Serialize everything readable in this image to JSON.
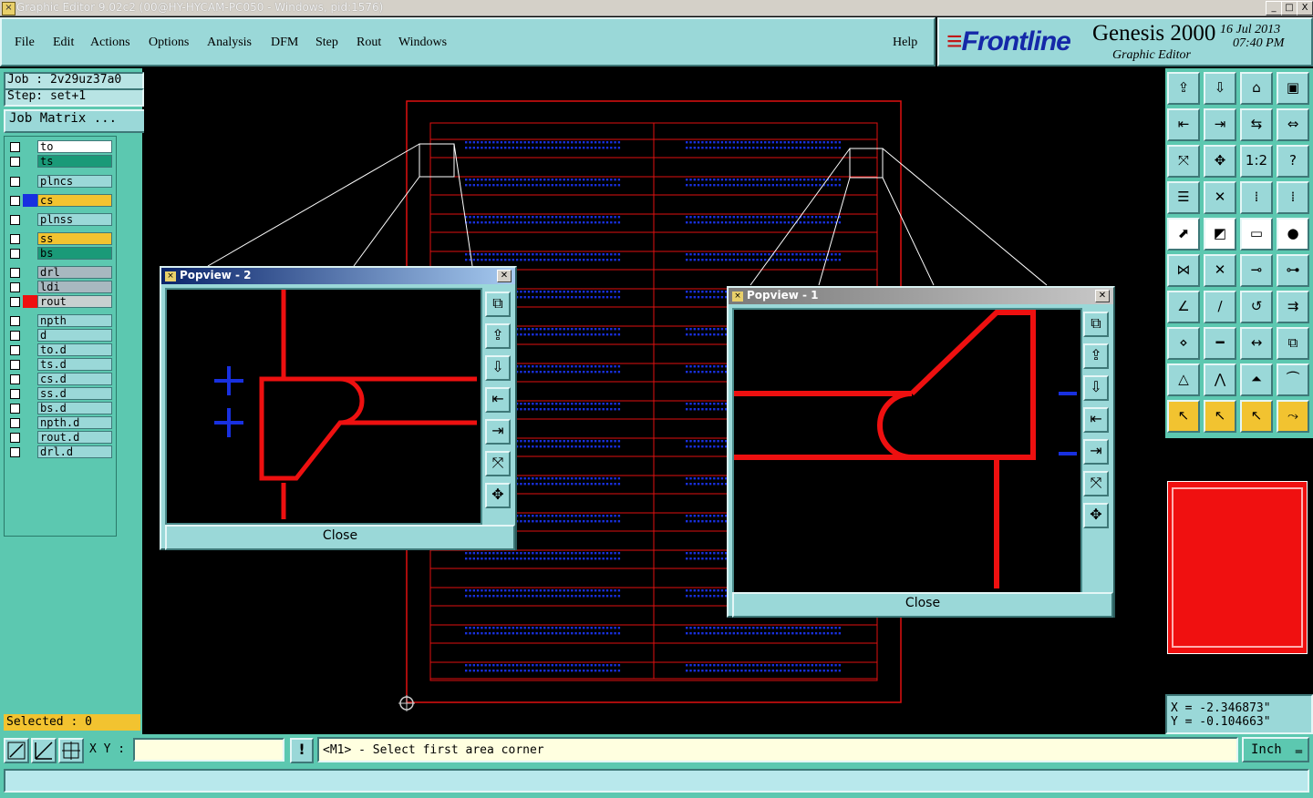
{
  "window": {
    "title": "Graphic Editor 9.02c2 (00@HY-HYCAM-PC050 - Windows, pid:1576)",
    "controls": [
      "_",
      "□",
      "X"
    ]
  },
  "menu": {
    "items": [
      "File",
      "Edit",
      "Actions",
      "Options",
      "Analysis",
      "DFM",
      "Step",
      "Rout",
      "Windows"
    ],
    "help": "Help"
  },
  "brand": {
    "logo": "Frontline",
    "product": "Genesis 2000",
    "subtitle": "Graphic Editor",
    "date": "16 Jul 2013",
    "time": "07:40 PM"
  },
  "job": {
    "job_label": "Job : 2v29uz37a0",
    "step_label": "Step: set+1",
    "matrix_button": "Job Matrix ..."
  },
  "layers": [
    {
      "name": "to",
      "bg": "#ffffff",
      "swatch": ""
    },
    {
      "name": "ts",
      "bg": "#1a9a78",
      "swatch": ""
    },
    {
      "name": "plncs",
      "bg": "#9ad8d8",
      "swatch": ""
    },
    {
      "name": "cs",
      "bg": "#f2c330",
      "swatch": "#1830e0"
    },
    {
      "name": "plnss",
      "bg": "#9ad8d8",
      "swatch": ""
    },
    {
      "name": "ss",
      "bg": "#f2c330",
      "swatch": ""
    },
    {
      "name": "bs",
      "bg": "#1a9a78",
      "swatch": ""
    },
    {
      "name": "drl",
      "bg": "#a8b8c0",
      "swatch": ""
    },
    {
      "name": "ldi",
      "bg": "#a8b8c0",
      "swatch": ""
    },
    {
      "name": "rout",
      "bg": "#c8d0d0",
      "swatch": "#ee1010"
    },
    {
      "name": "npth",
      "bg": "#9ad8d8",
      "swatch": ""
    },
    {
      "name": "d",
      "bg": "#9ad8d8",
      "swatch": ""
    },
    {
      "name": "to.d",
      "bg": "#9ad8d8",
      "swatch": ""
    },
    {
      "name": "ts.d",
      "bg": "#9ad8d8",
      "swatch": ""
    },
    {
      "name": "cs.d",
      "bg": "#9ad8d8",
      "swatch": ""
    },
    {
      "name": "ss.d",
      "bg": "#9ad8d8",
      "swatch": ""
    },
    {
      "name": "bs.d",
      "bg": "#9ad8d8",
      "swatch": ""
    },
    {
      "name": "npth.d",
      "bg": "#9ad8d8",
      "swatch": ""
    },
    {
      "name": "rout.d",
      "bg": "#9ad8d8",
      "swatch": ""
    },
    {
      "name": "drl.d",
      "bg": "#9ad8d8",
      "swatch": ""
    }
  ],
  "selected": "Selected : 0",
  "popview2": {
    "title": "Popview - 2",
    "close": "Close"
  },
  "popview1": {
    "title": "Popview - 1",
    "close": "Close"
  },
  "coords": {
    "x": "X = -2.346873\"",
    "y": "Y = -0.104663\""
  },
  "bottom": {
    "xy_label": "X Y :",
    "xy_value": "",
    "status": "<M1> - Select first area corner",
    "unit": "Inch"
  },
  "colors": {
    "rout": "#ee1010",
    "pads": "#1830e0",
    "panel": "#5cc8b0",
    "button": "#9ad8d8",
    "highlight": "#f2c330"
  }
}
